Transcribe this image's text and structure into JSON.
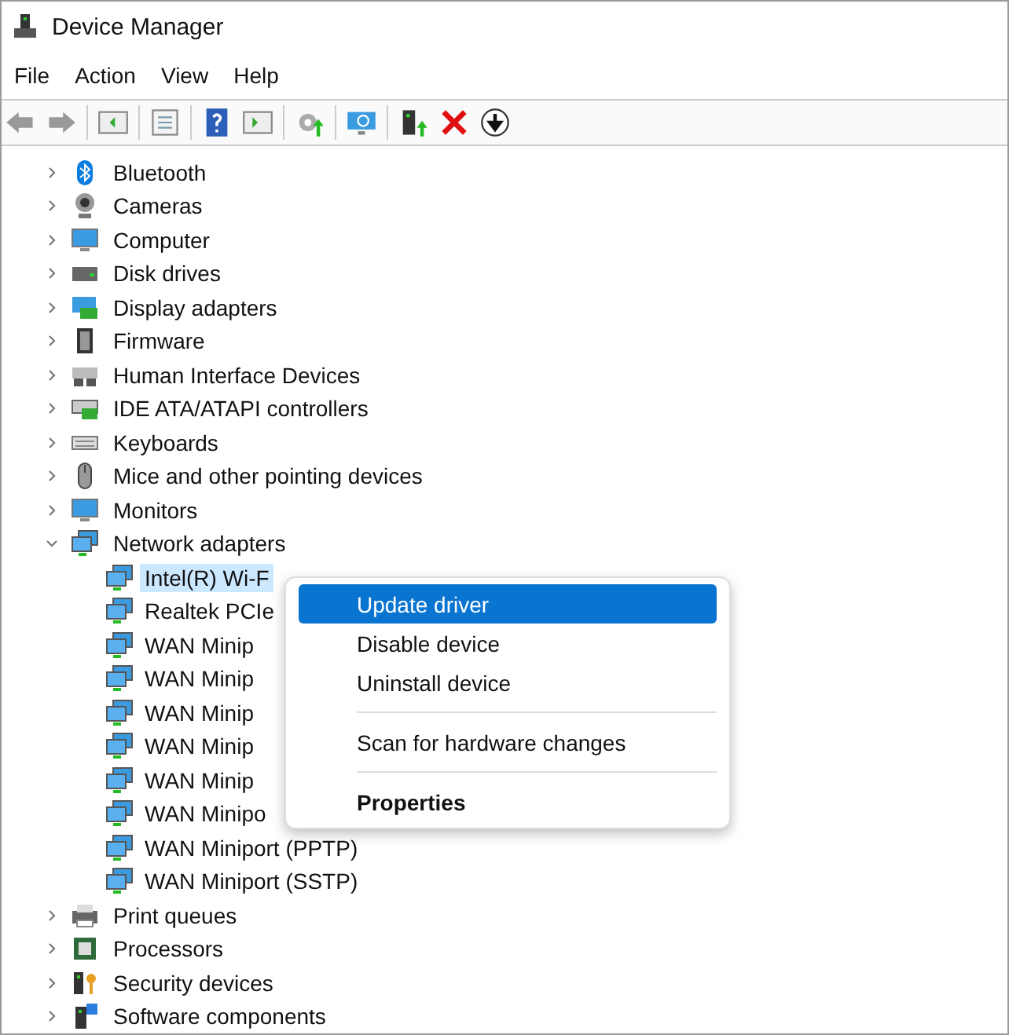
{
  "window": {
    "title": "Device Manager"
  },
  "menu": [
    "File",
    "Action",
    "View",
    "Help"
  ],
  "tree": [
    {
      "label": "Bluetooth",
      "expanded": false
    },
    {
      "label": "Cameras",
      "expanded": false
    },
    {
      "label": "Computer",
      "expanded": false
    },
    {
      "label": "Disk drives",
      "expanded": false
    },
    {
      "label": "Display adapters",
      "expanded": false
    },
    {
      "label": "Firmware",
      "expanded": false
    },
    {
      "label": "Human Interface Devices",
      "expanded": false
    },
    {
      "label": "IDE ATA/ATAPI controllers",
      "expanded": false
    },
    {
      "label": "Keyboards",
      "expanded": false
    },
    {
      "label": "Mice and other pointing devices",
      "expanded": false
    },
    {
      "label": "Monitors",
      "expanded": false
    },
    {
      "label": "Network adapters",
      "expanded": true,
      "children": [
        {
          "label": "Intel(R) Wi-F",
          "selected": true
        },
        {
          "label": "Realtek PCIe",
          "selected": false
        },
        {
          "label": "WAN Minip",
          "selected": false
        },
        {
          "label": "WAN Minip",
          "selected": false
        },
        {
          "label": "WAN Minip",
          "selected": false
        },
        {
          "label": "WAN Minip",
          "selected": false
        },
        {
          "label": "WAN Minip",
          "selected": false
        },
        {
          "label": "WAN Minipo",
          "selected": false
        },
        {
          "label": "WAN Miniport (PPTP)",
          "selected": false
        },
        {
          "label": "WAN Miniport (SSTP)",
          "selected": false
        }
      ]
    },
    {
      "label": "Print queues",
      "expanded": false
    },
    {
      "label": "Processors",
      "expanded": false
    },
    {
      "label": "Security devices",
      "expanded": false
    },
    {
      "label": "Software components",
      "expanded": false
    }
  ],
  "context_menu": [
    {
      "kind": "item",
      "label": "Update driver",
      "selected": true
    },
    {
      "kind": "item",
      "label": "Disable device",
      "selected": false
    },
    {
      "kind": "item",
      "label": "Uninstall device",
      "selected": false
    },
    {
      "kind": "separator"
    },
    {
      "kind": "item",
      "label": "Scan for hardware changes",
      "selected": false
    },
    {
      "kind": "separator"
    },
    {
      "kind": "default",
      "label": "Properties",
      "selected": false
    }
  ]
}
